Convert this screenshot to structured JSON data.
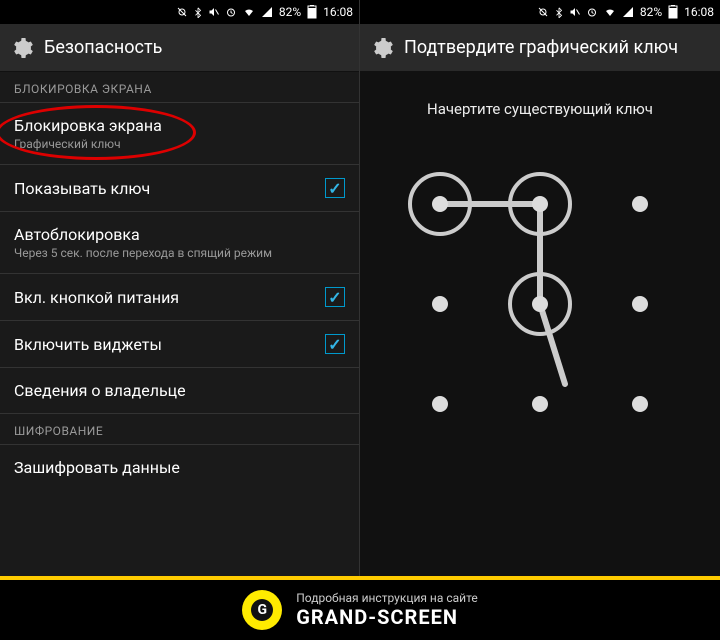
{
  "status": {
    "battery": "82%",
    "time": "16:08"
  },
  "left": {
    "title": "Безопасность",
    "section1": "БЛОКИРОВКА ЭКРАНА",
    "items": [
      {
        "title": "Блокировка экрана",
        "sub": "Графический ключ",
        "highlighted": true
      },
      {
        "title": "Показывать ключ",
        "checked": true
      },
      {
        "title": "Автоблокировка",
        "sub": "Через 5 сек. после перехода в спящий режим"
      },
      {
        "title": "Вкл. кнопкой питания",
        "checked": true
      },
      {
        "title": "Включить виджеты",
        "checked": true
      },
      {
        "title": "Сведения о владельце"
      }
    ],
    "section2": "ШИФРОВАНИЕ",
    "encrypt": "Зашифровать данные"
  },
  "right": {
    "title": "Подтвердите графический ключ",
    "prompt": "Начертите существующий ключ"
  },
  "banner": {
    "line1": "Подробная инструкция на сайте",
    "line2": "GRAND-SCREEN",
    "g": "G"
  }
}
